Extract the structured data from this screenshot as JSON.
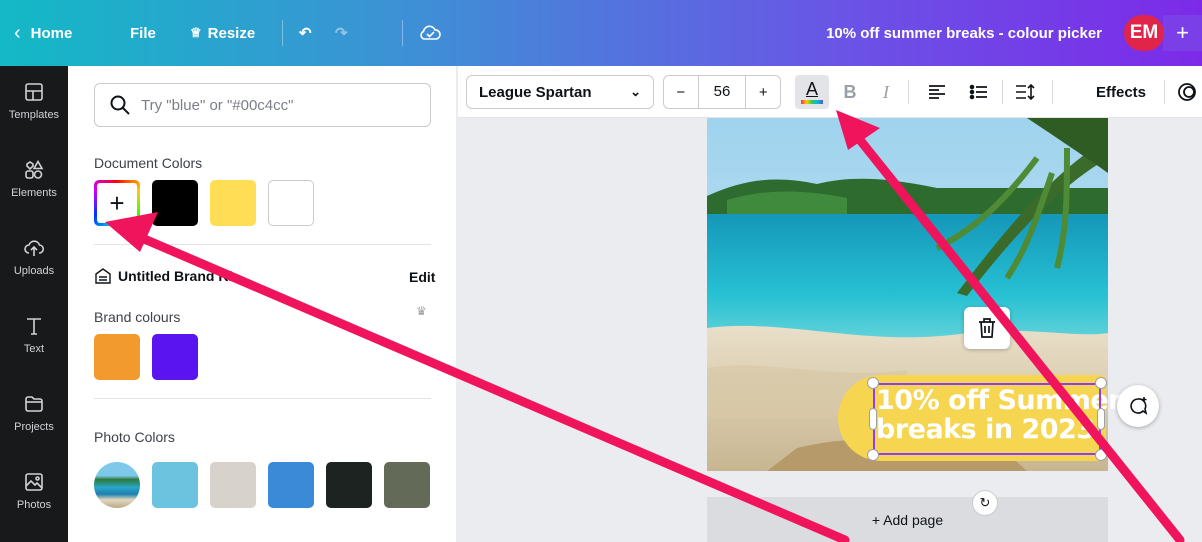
{
  "topbar": {
    "home_label": "Home",
    "file_label": "File",
    "resize_label": "Resize",
    "doc_title": "10% off summer breaks - colour picker",
    "avatar_initials": "EM",
    "add_icon": "+"
  },
  "rail": {
    "items": [
      {
        "label": "Templates",
        "icon": "templates-icon"
      },
      {
        "label": "Elements",
        "icon": "elements-icon"
      },
      {
        "label": "Uploads",
        "icon": "uploads-icon"
      },
      {
        "label": "Text",
        "icon": "text-icon"
      },
      {
        "label": "Projects",
        "icon": "projects-icon"
      },
      {
        "label": "Photos",
        "icon": "photos-icon"
      }
    ]
  },
  "panel": {
    "search_placeholder": "Try \"blue\" or \"#00c4cc\"",
    "document_colors_label": "Document Colors",
    "document_colors": [
      "#000000",
      "#ffdd55",
      "#ffffff"
    ],
    "brand_kit_label": "Untitled Brand Ki",
    "edit_label": "Edit",
    "brand_colours_label": "Brand colours",
    "brand_colours": [
      "#f29a2e",
      "#5a14f0"
    ],
    "photo_colors_label": "Photo Colors",
    "photo_colors": [
      "#6cc3e0",
      "#d8d2cc",
      "#3a8ad8",
      "#1d2321",
      "#636b58"
    ]
  },
  "toolbar": {
    "font_name": "League Spartan",
    "font_size": "56",
    "minus": "−",
    "plus": "+",
    "text_color_glyph": "A",
    "bold_glyph": "B",
    "italic_glyph": "I",
    "effects_label": "Effects"
  },
  "canvas": {
    "headline_line1": "10% off Summer",
    "headline_line2": "breaks in 2023",
    "add_page_label": "+ Add page"
  },
  "colors": {
    "annotation_arrow": "#f0145c",
    "selection": "#8b3dff",
    "text_pill": "#f6d550"
  }
}
